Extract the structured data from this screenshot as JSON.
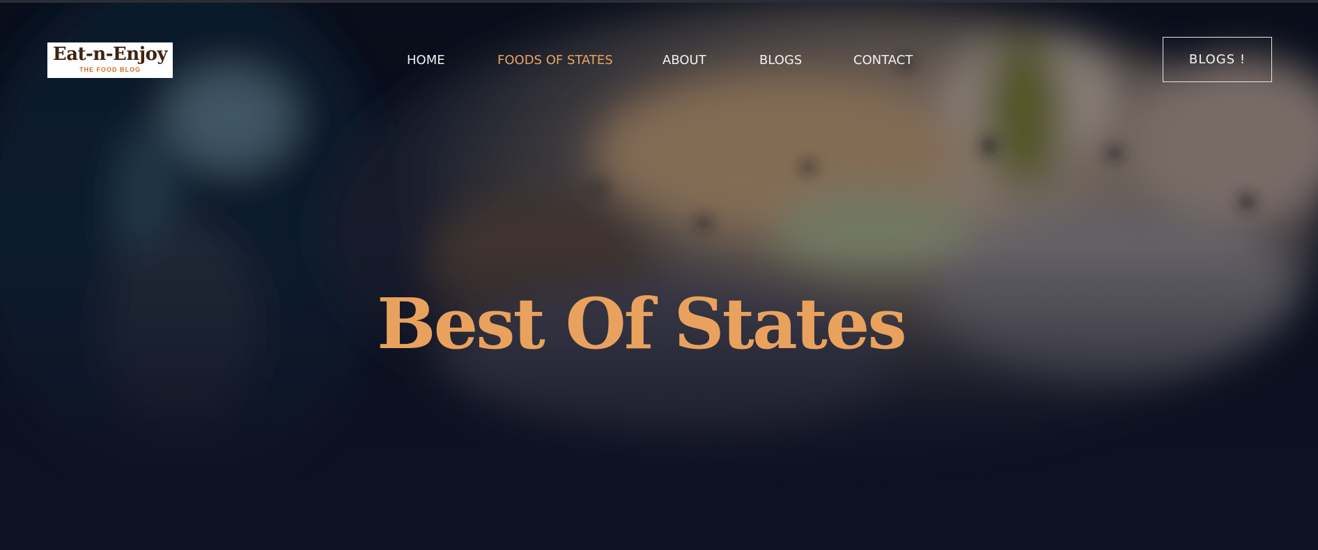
{
  "brand": {
    "logo_title": "Eat-n-Enjoy",
    "logo_subtitle": "THE FOOD BLOG"
  },
  "nav": {
    "items": [
      {
        "label": "HOME",
        "active": false
      },
      {
        "label": "FOODS OF STATES",
        "active": true
      },
      {
        "label": "ABOUT",
        "active": false
      },
      {
        "label": "BLOGS",
        "active": false
      },
      {
        "label": "CONTACT",
        "active": false
      }
    ]
  },
  "cta": {
    "label": "BLOGS !"
  },
  "hero": {
    "headline": "Best Of States"
  },
  "colors": {
    "accent": "#e9a563",
    "nav_text": "#f2f2f2",
    "background": "#0e1122",
    "logo_brown": "#3d2410",
    "logo_orange": "#d06a1f"
  }
}
